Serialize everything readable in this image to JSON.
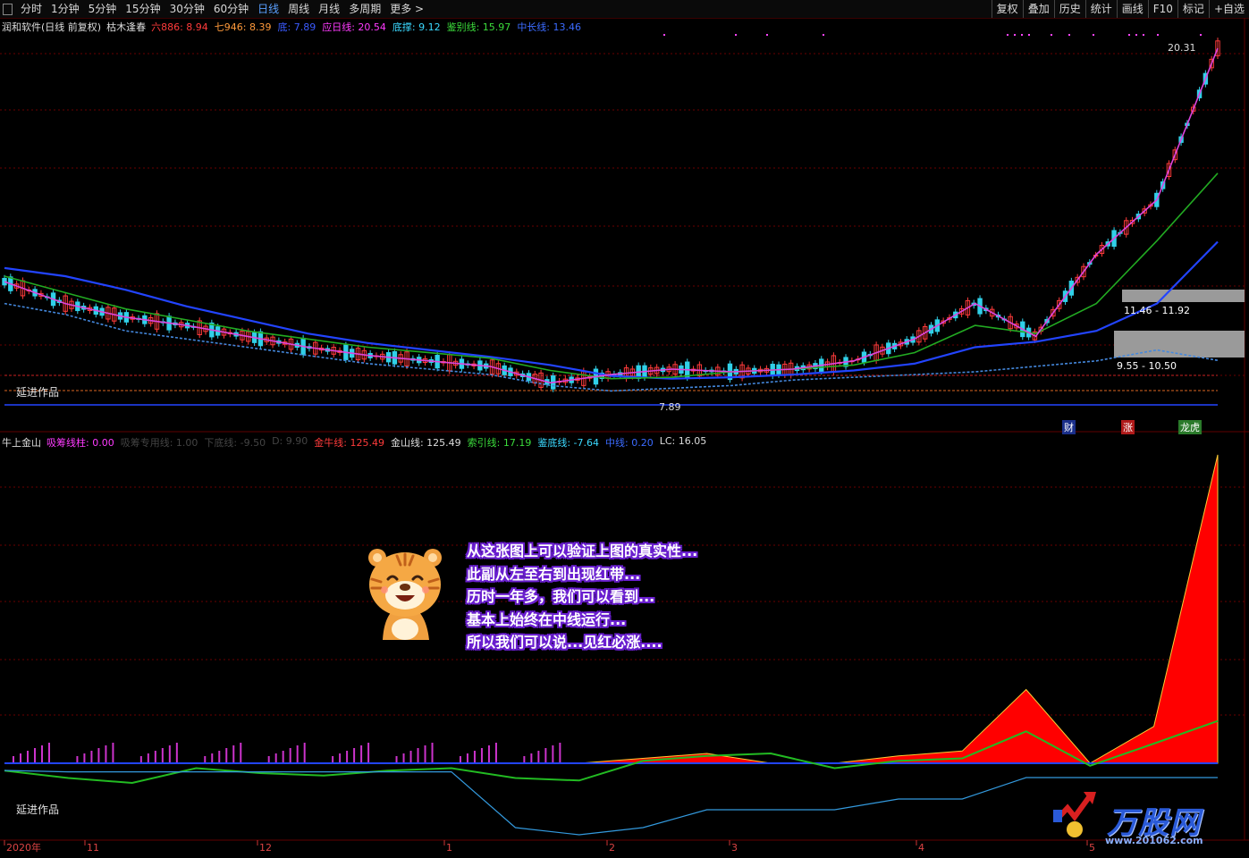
{
  "toolbar": {
    "periods": [
      "分时",
      "1分钟",
      "5分钟",
      "15分钟",
      "30分钟",
      "60分钟",
      "日线",
      "周线",
      "月线",
      "多周期",
      "更多 >"
    ],
    "active_period": "日线",
    "right_items": [
      "复权",
      "叠加",
      "历史",
      "统计",
      "画线",
      "F10",
      "标记",
      "+自选"
    ]
  },
  "main_legend": {
    "stock": "润和软件(日线 前复权)",
    "indicator": "枯木逢春",
    "items": [
      {
        "label": "六886",
        "value": "8.94",
        "color": "#ff3b3b"
      },
      {
        "label": "七946",
        "value": "8.39",
        "color": "#ff9a3b"
      },
      {
        "label": "底",
        "value": "7.89",
        "color": "#3b5bff"
      },
      {
        "label": "应日线",
        "value": "20.54",
        "color": "#ff3bff"
      },
      {
        "label": "底撑",
        "value": "9.12",
        "color": "#3bd9ff"
      },
      {
        "label": "鉴别线",
        "value": "15.97",
        "color": "#3bdc3b"
      },
      {
        "label": "中长线",
        "value": "13.46",
        "color": "#3b6bff"
      }
    ]
  },
  "sub_legend": {
    "indicator": "牛上金山",
    "items": [
      {
        "label": "吸筹线柱",
        "value": "0.00",
        "color": "#ff3bff"
      },
      {
        "label": "吸筹专用线",
        "value": "1.00",
        "color": "#444444"
      },
      {
        "label": "下底线",
        "value": "-9.50",
        "color": "#444444"
      },
      {
        "label": "D",
        "value": "9.90",
        "color": "#444444"
      },
      {
        "label": "金牛线",
        "value": "125.49",
        "color": "#ff3b3b"
      },
      {
        "label": "金山线",
        "value": "125.49",
        "color": "#dddddd"
      },
      {
        "label": "索引线",
        "value": "17.19",
        "color": "#3bdc3b"
      },
      {
        "label": "鉴底线",
        "value": "-7.64",
        "color": "#3bd9ff"
      },
      {
        "label": "中线",
        "value": "0.20",
        "color": "#3b6bff"
      },
      {
        "label": "LC",
        "value": "16.05",
        "color": "#dddddd"
      }
    ]
  },
  "labels": {
    "author_main": "延进作品",
    "author_sub": "延进作品",
    "high_price": "20.31",
    "low_price": "7.89",
    "zone_upper": "11.46 - 11.92",
    "zone_lower": "9.55 - 10.50",
    "tag_cai": "财",
    "tag_zhang": "涨",
    "tag_longhu": "龙虎"
  },
  "note_lines": [
    "从这张图上可以验证上图的真实性...",
    "此副从左至右到出现红带...",
    "历时一年多，我们可以看到...",
    "基本上始终在中线运行...",
    "所以我们可以说...见红必涨...."
  ],
  "watermark": {
    "brand": "万股网",
    "url": "www.201062.com"
  },
  "chart_data": [
    {
      "type": "line",
      "title": "枯木逢春",
      "x": [
        "2020年",
        "11",
        "12",
        "1",
        "2",
        "3",
        "4",
        "5"
      ],
      "ylim": [
        7.0,
        21.0
      ],
      "annotations": {
        "high": 20.31,
        "low": 7.89
      },
      "series": [
        {
          "name": "中长线",
          "color": "#2244ff",
          "values": [
            12.5,
            12.2,
            11.7,
            11.1,
            10.6,
            10.1,
            9.75,
            9.5,
            9.25,
            8.95,
            8.55,
            8.45,
            8.5,
            8.6,
            8.75,
            9.0,
            9.6,
            9.8,
            10.2,
            11.2,
            13.46
          ]
        },
        {
          "name": "鉴别线",
          "color": "#22aa22",
          "values": [
            12.2,
            11.6,
            11.0,
            10.6,
            10.2,
            9.9,
            9.6,
            9.4,
            9.2,
            8.75,
            8.45,
            8.5,
            8.7,
            8.8,
            8.95,
            9.4,
            10.4,
            10.1,
            11.2,
            13.5,
            15.97
          ]
        },
        {
          "name": "应日线",
          "color": "#dd44dd",
          "values": [
            12.0,
            11.2,
            10.7,
            10.4,
            10.0,
            9.6,
            9.3,
            9.1,
            8.9,
            8.3,
            8.6,
            8.8,
            8.7,
            8.8,
            9.1,
            9.9,
            11.2,
            10.0,
            13.0,
            15.0,
            20.54
          ]
        },
        {
          "name": "底撑",
          "color": "#4488dd",
          "values": [
            11.2,
            10.8,
            10.2,
            9.9,
            9.6,
            9.3,
            9.0,
            8.8,
            8.6,
            8.2,
            8.0,
            8.1,
            8.2,
            8.4,
            8.5,
            8.6,
            8.7,
            8.9,
            9.1,
            9.5,
            9.12
          ]
        }
      ],
      "zones": [
        {
          "low": 11.46,
          "high": 11.92
        },
        {
          "low": 9.55,
          "high": 10.5
        }
      ]
    },
    {
      "type": "area",
      "title": "牛上金山",
      "x": [
        "2020年",
        "11",
        "12",
        "1",
        "2",
        "3",
        "4",
        "5"
      ],
      "series": [
        {
          "name": "金牛线",
          "color": "#ff0000",
          "values": [
            0,
            0,
            0,
            0,
            0,
            0,
            0,
            0,
            0,
            0,
            2,
            4,
            0,
            0,
            3,
            5,
            30,
            0,
            15,
            125.49
          ]
        },
        {
          "name": "索引线",
          "color": "#22bb22",
          "values": [
            -3,
            -6,
            -8,
            -2,
            -4,
            -5,
            -3,
            -2,
            -6,
            -7,
            1,
            3,
            4,
            -2,
            1,
            2,
            13,
            -1,
            8,
            17.19
          ]
        },
        {
          "name": "吸筹线柱",
          "color": "#cc33cc",
          "values": [
            1,
            1,
            1,
            1,
            1,
            1,
            1,
            1,
            1,
            0,
            0,
            0,
            0,
            0,
            0,
            0,
            0,
            0,
            0,
            0.0
          ]
        }
      ]
    }
  ]
}
